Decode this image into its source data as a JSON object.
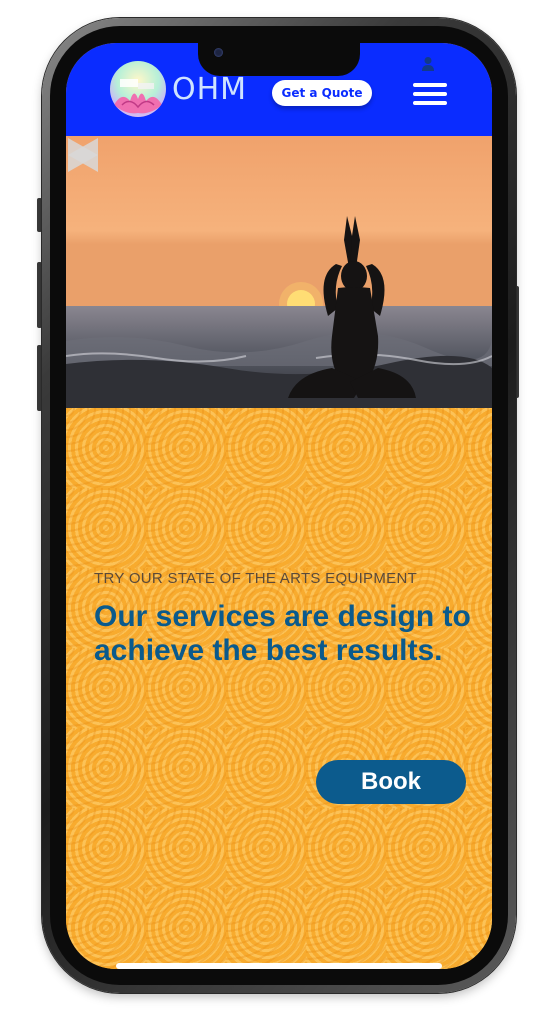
{
  "header": {
    "brand_name": "OHM",
    "quote_button_label": "Get a Quote",
    "icons": [
      "user-icon",
      "menu-icon"
    ]
  },
  "hero": {
    "prev_icon": "chevron-left-icon",
    "next_icon": "chevron-right-icon"
  },
  "content": {
    "kicker": "TRY OUR STATE OF THE ARTS EQUIPMENT",
    "headline": "Our services are design to achieve the best results.",
    "book_button_label": "Book"
  },
  "colors": {
    "header_bg": "#0a2cff",
    "content_bg": "#f8ab2e",
    "headline": "#0a5a8c",
    "book_button": "#0c5b8d"
  }
}
